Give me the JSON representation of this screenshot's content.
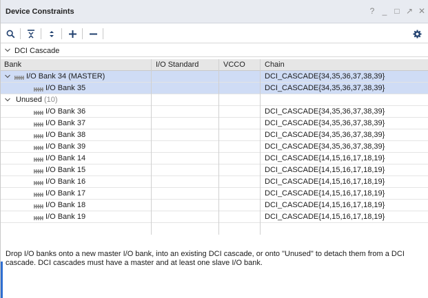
{
  "window": {
    "title": "Device Constraints",
    "controls": [
      "?",
      "_",
      "□",
      "↗",
      "✕"
    ]
  },
  "toolbar": {
    "buttons": [
      "search-icon",
      "collapse-all-icon",
      "expand-all-icon",
      "add-icon",
      "remove-icon"
    ],
    "settings": "gear-icon"
  },
  "group": {
    "label": "DCI Cascade"
  },
  "columns": [
    "Bank",
    "I/O Standard",
    "VCCO",
    "Chain"
  ],
  "rows": [
    {
      "bank": "I/O Bank 34 (MASTER)",
      "io": "",
      "vcco": "",
      "chain": "DCI_CASCADE{34,35,36,37,38,39}",
      "selected": true,
      "expander": true,
      "indent": 1
    },
    {
      "bank": "I/O Bank 35",
      "io": "",
      "vcco": "",
      "chain": "DCI_CASCADE{34,35,36,37,38,39}",
      "selected": true,
      "expander": false,
      "indent": 2
    },
    {
      "bank": "Unused",
      "count": "(10)",
      "io": "",
      "vcco": "",
      "chain": "",
      "selected": false,
      "expander": true,
      "indent": 0,
      "noicon": true
    },
    {
      "bank": "I/O Bank 36",
      "io": "",
      "vcco": "",
      "chain": "DCI_CASCADE{34,35,36,37,38,39}",
      "selected": false,
      "indent": 2
    },
    {
      "bank": "I/O Bank 37",
      "io": "",
      "vcco": "",
      "chain": "DCI_CASCADE{34,35,36,37,38,39}",
      "selected": false,
      "indent": 2
    },
    {
      "bank": "I/O Bank 38",
      "io": "",
      "vcco": "",
      "chain": "DCI_CASCADE{34,35,36,37,38,39}",
      "selected": false,
      "indent": 2
    },
    {
      "bank": "I/O Bank 39",
      "io": "",
      "vcco": "",
      "chain": "DCI_CASCADE{34,35,36,37,38,39}",
      "selected": false,
      "indent": 2
    },
    {
      "bank": "I/O Bank 14",
      "io": "",
      "vcco": "",
      "chain": "DCI_CASCADE{14,15,16,17,18,19}",
      "selected": false,
      "indent": 2
    },
    {
      "bank": "I/O Bank 15",
      "io": "",
      "vcco": "",
      "chain": "DCI_CASCADE{14,15,16,17,18,19}",
      "selected": false,
      "indent": 2
    },
    {
      "bank": "I/O Bank 16",
      "io": "",
      "vcco": "",
      "chain": "DCI_CASCADE{14,15,16,17,18,19}",
      "selected": false,
      "indent": 2
    },
    {
      "bank": "I/O Bank 17",
      "io": "",
      "vcco": "",
      "chain": "DCI_CASCADE{14,15,16,17,18,19}",
      "selected": false,
      "indent": 2
    },
    {
      "bank": "I/O Bank 18",
      "io": "",
      "vcco": "",
      "chain": "DCI_CASCADE{14,15,16,17,18,19}",
      "selected": false,
      "indent": 2
    },
    {
      "bank": "I/O Bank 19",
      "io": "",
      "vcco": "",
      "chain": "DCI_CASCADE{14,15,16,17,18,19}",
      "selected": false,
      "indent": 2
    }
  ],
  "info": "Drop I/O banks onto a new master I/O bank, into an existing DCI cascade, or onto \"Unused\" to detach them from a DCI cascade. DCI cascades must have a master and at least one slave I/O bank.",
  "colors": {
    "selection": "#cfdcf5",
    "header": "#e6e6e6",
    "titlebar": "#e8ebf1",
    "accent": "#1f3f6e"
  }
}
